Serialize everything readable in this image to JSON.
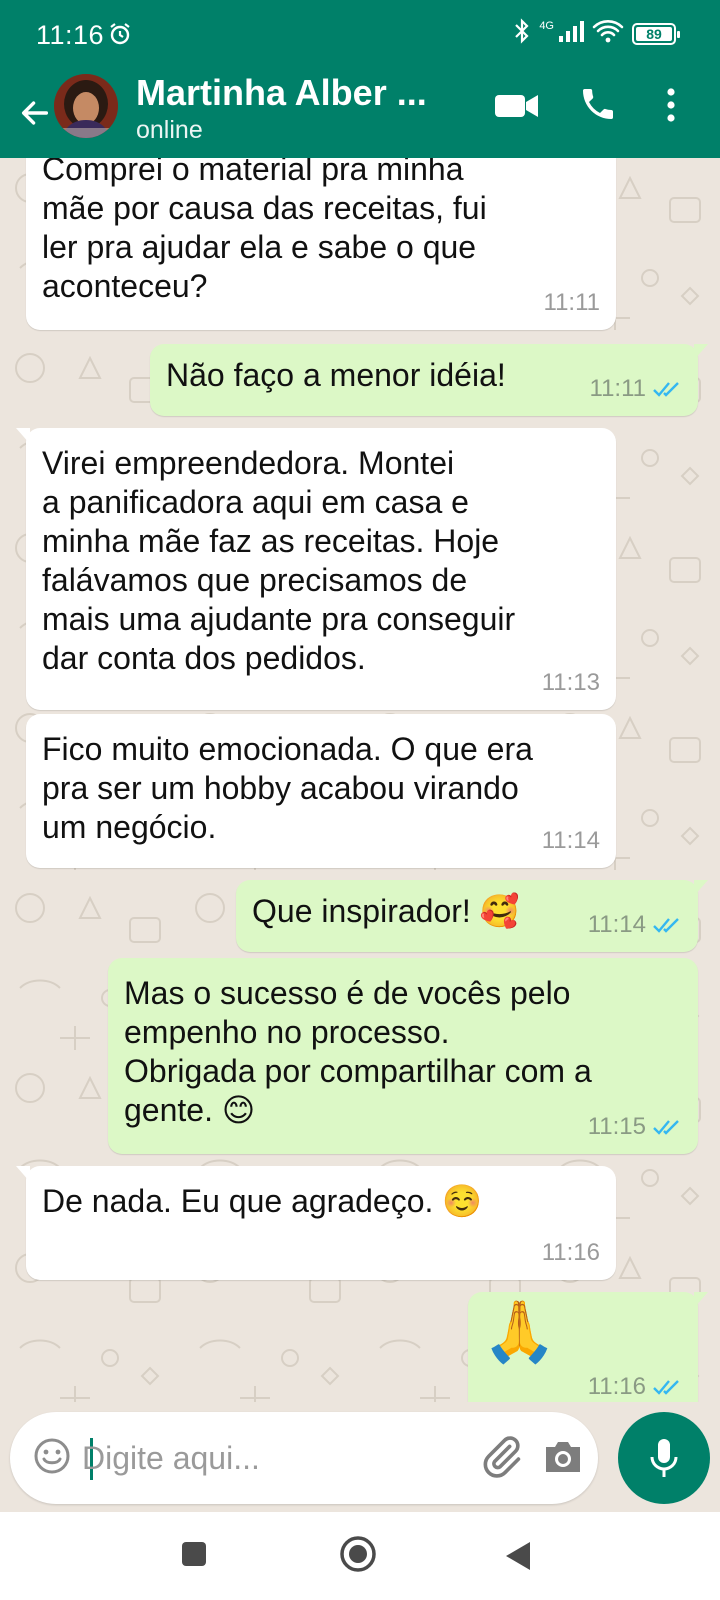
{
  "status_bar": {
    "time": "11:16",
    "network": "4G",
    "battery": "89"
  },
  "header": {
    "contact_name": "Martinha Alber ...",
    "contact_status": "online"
  },
  "messages": [
    {
      "direction": "in",
      "text": "Comprei o material pra minha\nmãe por causa das receitas, fui\nler pra ajudar ela e sabe o que\naconteceu?",
      "time": "11:11"
    },
    {
      "direction": "out",
      "text": "Não faço a menor idéia!",
      "time": "11:11",
      "status": "read"
    },
    {
      "direction": "in",
      "text": "Virei empreendedora. Montei\na panificadora aqui em casa e\nminha mãe faz as receitas. Hoje\nfalávamos que precisamos de\nmais uma ajudante pra conseguir\ndar conta dos pedidos.",
      "time": "11:13"
    },
    {
      "direction": "in",
      "text": "Fico muito emocionada. O que era\npra ser um hobby acabou virando\num negócio.",
      "time": "11:14"
    },
    {
      "direction": "out",
      "text": "Que inspirador! 🥰",
      "time": "11:14",
      "status": "read"
    },
    {
      "direction": "out",
      "text": "Mas o sucesso é de vocês pelo\nempenho no processo.\nObrigada por compartilhar com a\ngente. 😊",
      "time": "11:15",
      "status": "read"
    },
    {
      "direction": "in",
      "text": "De nada. Eu que agradeço. ☺️",
      "time": "11:16"
    },
    {
      "direction": "out",
      "text": "🙏",
      "time": "11:16",
      "status": "read"
    }
  ],
  "composer": {
    "placeholder": "Digite aqui..."
  },
  "icons": {
    "back": "arrow-left-icon",
    "video": "video-call-icon",
    "call": "phone-icon",
    "menu": "more-vert-icon",
    "emoji": "emoji-icon",
    "attach": "paperclip-icon",
    "camera": "camera-icon",
    "mic": "mic-icon"
  },
  "colors": {
    "header": "#008069",
    "outgoing_bubble": "#dcf8c6",
    "incoming_bubble": "#ffffff",
    "read_ticks": "#34b7f1",
    "chat_background": "#ece5dd"
  }
}
